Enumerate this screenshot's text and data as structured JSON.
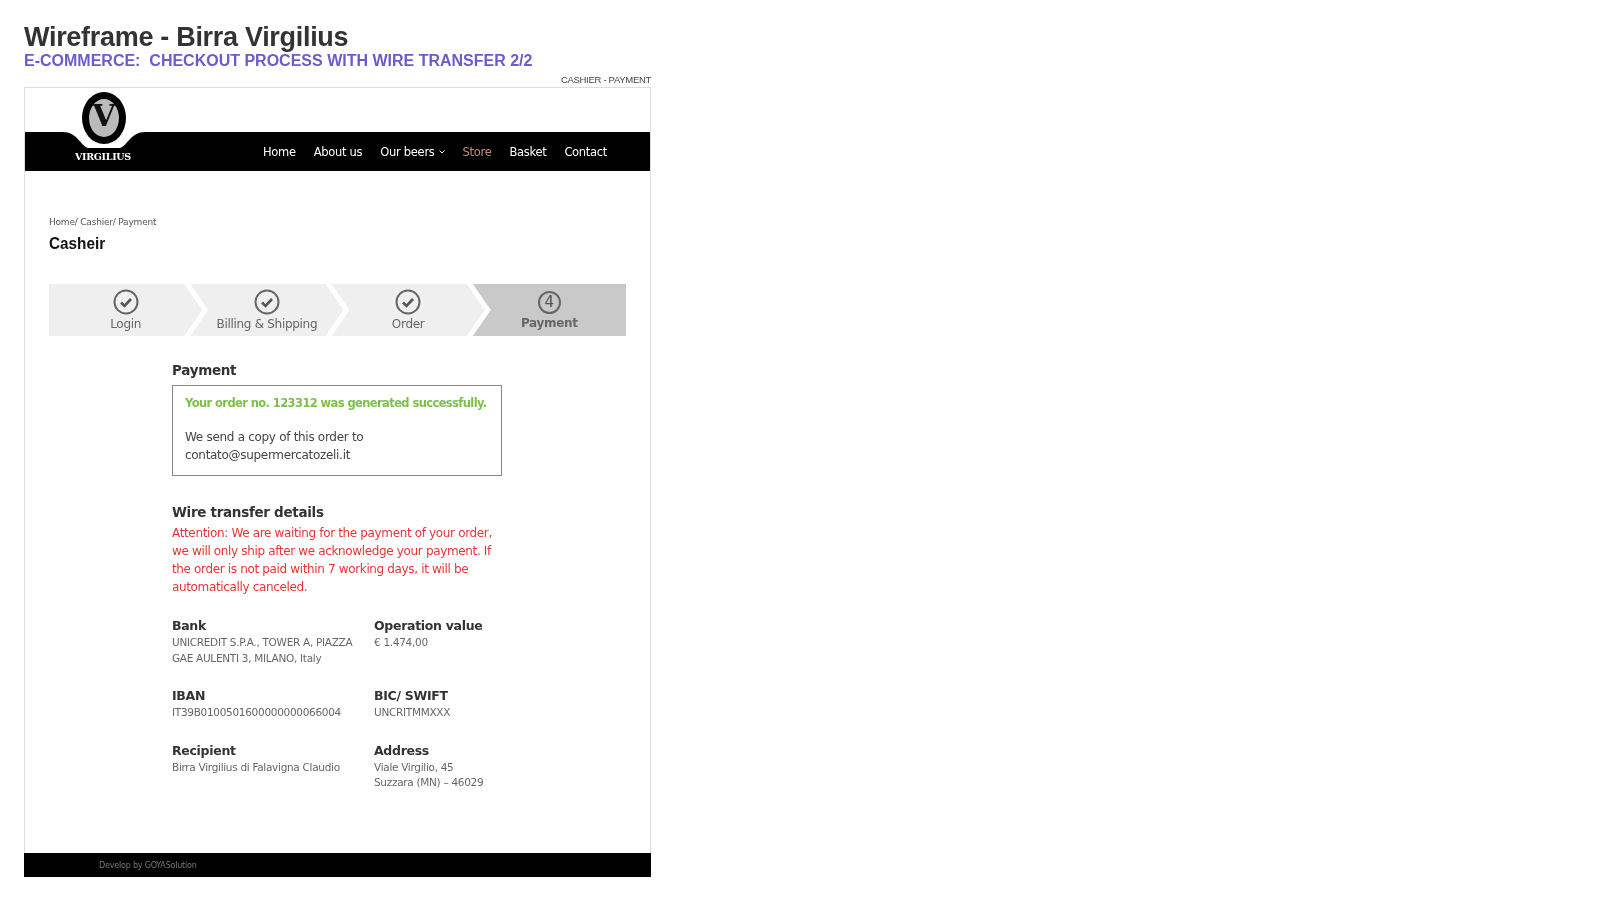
{
  "doc": {
    "title": "Wireframe - Birra Virgilius",
    "subtitle": "E-COMMERCE:  CHECKOUT PROCESS WITH WIRE TRANSFER 2/2",
    "screen_label": "CASHIER - PAYMENT"
  },
  "logo": {
    "monogram": "V",
    "name": "VIRGILIUS"
  },
  "nav": [
    {
      "label": "Home",
      "selected": false,
      "has_menu": false
    },
    {
      "label": "About us",
      "selected": false,
      "has_menu": false
    },
    {
      "label": "Our beers",
      "selected": false,
      "has_menu": true
    },
    {
      "label": "Store",
      "selected": true,
      "has_menu": false
    },
    {
      "label": "Basket",
      "selected": false,
      "has_menu": false
    },
    {
      "label": "Contact",
      "selected": false,
      "has_menu": false
    }
  ],
  "breadcrumb": "Home/ Cashier/ Payment",
  "page_title": "Casheir",
  "steps": [
    {
      "label": "Login",
      "selected": false,
      "completed": true
    },
    {
      "label": "Billing & Shipping",
      "selected": false,
      "completed": true
    },
    {
      "label": "Order",
      "selected": false,
      "completed": true
    },
    {
      "label": "Payment",
      "selected": true,
      "completed": false,
      "number": "4"
    }
  ],
  "payment": {
    "heading": "Payment",
    "success": "Your order no. 123312 was generated successfully.",
    "copy_note": "We send a copy of this order to contato@supermercatozeli.it"
  },
  "wire": {
    "heading": "Wire transfer details",
    "warning": "Attention: We are waiting for the payment of your order, we will only ship after we acknowledge your payment. If the order is not paid within 7 working days, it will be automatically canceled.",
    "fields": [
      {
        "label": "Bank",
        "value": "UNICREDIT S.P.A., TOWER A, PIAZZA GAE AULENTI 3, MILANO, Italy"
      },
      {
        "label": "Operation value",
        "value": "€ 1.474,00"
      },
      {
        "label": "IBAN",
        "value": "IT39B0100501600000000066004"
      },
      {
        "label": "BIC/ SWIFT",
        "value": "UNCRITMMXXX"
      },
      {
        "label": "Recipient",
        "value": "Birra Virgilius di Falavigna Claudio"
      },
      {
        "label": "Address",
        "value": "Viale Virgilio, 45\nSuzzara (MN) – 46029"
      }
    ]
  },
  "footer": "Develop by GOYASolution"
}
